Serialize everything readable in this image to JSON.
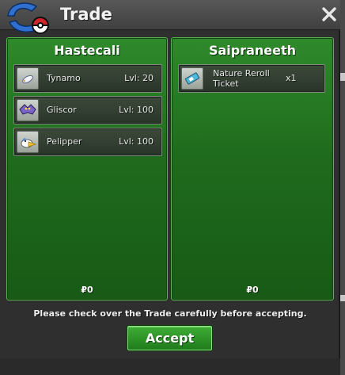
{
  "window": {
    "title": "Trade",
    "close_icon": "close-icon",
    "logo_icon": "pokeball-logo-icon"
  },
  "left_panel": {
    "trader_name": "Hastecali",
    "items": [
      {
        "name": "Tynamo",
        "level": "Lvl: 20",
        "icon": "tynamo-icon"
      },
      {
        "name": "Gliscor",
        "level": "Lvl: 100",
        "icon": "gliscor-icon"
      },
      {
        "name": "Pelipper",
        "level": "Lvl: 100",
        "icon": "pelipper-icon"
      }
    ],
    "money": "₽0"
  },
  "right_panel": {
    "trader_name": "Saipraneeth",
    "items": [
      {
        "name": "Nature Reroll Ticket",
        "quantity": "x1",
        "icon": "ticket-icon"
      }
    ],
    "money": "₽0"
  },
  "footer": {
    "notice": "Please check over the Trade carefully before accepting.",
    "accept_label": "Accept"
  },
  "colors": {
    "panel_green": "#1f6b1d",
    "accept_green": "#2f9a28",
    "titlebar": "#4a4a4a"
  }
}
